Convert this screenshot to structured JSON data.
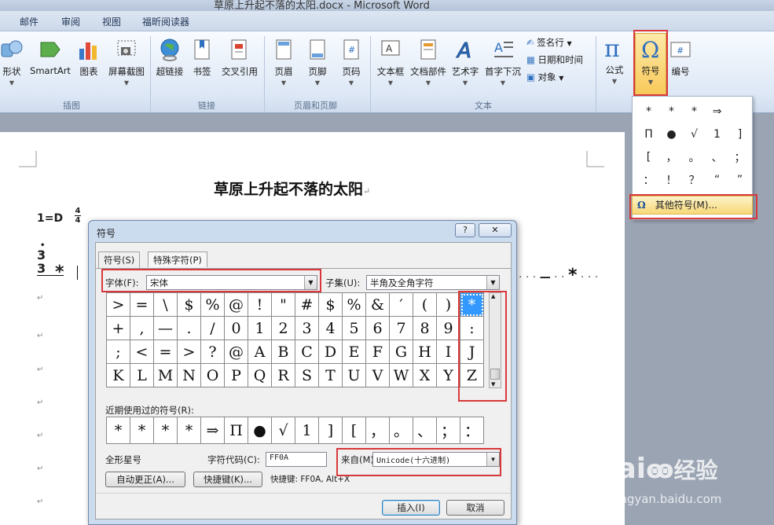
{
  "window": {
    "title": "草原上升起不落的太阳.docx - Microsoft Word"
  },
  "ribbon_tabs": [
    "邮件",
    "审阅",
    "视图",
    "福昕阅读器"
  ],
  "ribbon": {
    "illustrations": {
      "shapes": "形状",
      "smartart": "SmartArt",
      "chart": "图表",
      "screenshot": "屏幕截图",
      "group": "插图"
    },
    "links": {
      "hyperlink": "超链接",
      "bookmark": "书签",
      "crossref": "交叉引用",
      "group": "链接"
    },
    "header_footer": {
      "header": "页眉",
      "footer": "页脚",
      "page_number": "页码",
      "group": "页眉和页脚"
    },
    "text": {
      "textbox": "文本框",
      "quickparts": "文档部件",
      "wordart": "艺术字",
      "dropcap": "首字下沉",
      "signature": "签名行",
      "datetime": "日期和时间",
      "object": "对象",
      "group": "文本"
    },
    "symbols": {
      "equation": "公式",
      "symbol": "符号",
      "numbering": "编号"
    }
  },
  "symbol_popup": {
    "symbols": [
      "*",
      "*",
      "*",
      "⇒",
      "",
      "Π",
      "●",
      "√",
      "1",
      "]",
      "[",
      "，",
      "。",
      "、",
      "；",
      "：",
      "！",
      "？",
      "“",
      "”"
    ],
    "more": "其他符号(M)..."
  },
  "document": {
    "title": "草原上升起不落的太阳",
    "return_mark": "↵",
    "key": "1=D",
    "time_sig_top": "4",
    "time_sig_bottom": "4",
    "note_top": "3",
    "note_bottom": "3",
    "star": "*",
    "dash": "—",
    "right_star": "*"
  },
  "dialog": {
    "title": "符号",
    "help": "?",
    "close": "✕",
    "tabs": [
      "符号(S)",
      "特殊字符(P)"
    ],
    "font_label": "字体(F):",
    "font_value": "宋体",
    "subset_label": "子集(U):",
    "subset_value": "半角及全角字符",
    "chars": [
      ">",
      "=",
      "\\",
      "$",
      "%",
      "@",
      "!",
      "\"",
      "#",
      "$",
      "%",
      "&",
      "′",
      "(",
      ")",
      "*",
      "+",
      ",",
      "—",
      ".",
      "/",
      "0",
      "1",
      "2",
      "3",
      "4",
      "5",
      "6",
      "7",
      "8",
      "9",
      ":",
      ";",
      "<",
      "=",
      ">",
      "?",
      "@",
      "A",
      "B",
      "C",
      "D",
      "E",
      "F",
      "G",
      "H",
      "I",
      "J",
      "K",
      "L",
      "M",
      "N",
      "O",
      "P",
      "Q",
      "R",
      "S",
      "T",
      "U",
      "V",
      "W",
      "X",
      "Y",
      "Z"
    ],
    "selected_index": 15,
    "recent_label": "近期使用过的符号(R):",
    "recent": [
      "*",
      "*",
      "*",
      "*",
      "⇒",
      "Π",
      "●",
      "√",
      "1",
      "]",
      "[",
      "，",
      "。",
      "、",
      "；",
      "："
    ],
    "char_name": "全形星号",
    "charcode_label": "字符代码(C):",
    "charcode_value": "FF0A",
    "from_label": "来自(M):",
    "from_value": "Unicode(十六进制)",
    "autocorrect": "自动更正(A)...",
    "shortcut_key": "快捷键(K)...",
    "shortcut_text": "快捷键: FF0A, Alt+X",
    "insert": "插入(I)",
    "cancel": "取消"
  },
  "watermark": {
    "brand": "Bai",
    "brand2": "经验",
    "url": "jingyan.baidu.com"
  },
  "colors": {
    "highlight": "#d9383a",
    "selection": "#3399ff"
  }
}
